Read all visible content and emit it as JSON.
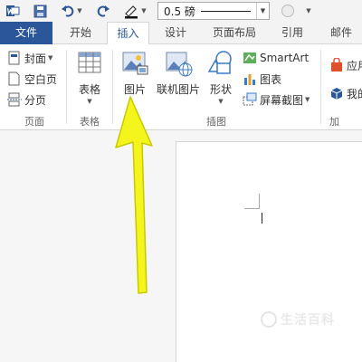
{
  "qat": {
    "line_weight": "0.5 磅"
  },
  "tabs": [
    {
      "label": "文件"
    },
    {
      "label": "开始"
    },
    {
      "label": "插入"
    },
    {
      "label": "设计"
    },
    {
      "label": "页面布局"
    },
    {
      "label": "引用"
    },
    {
      "label": "邮件"
    }
  ],
  "ribbon": {
    "pages": {
      "cover": "封面",
      "blank": "空白页",
      "break": "分页",
      "group_label": "页面"
    },
    "tables": {
      "table": "表格",
      "group_label": "表格"
    },
    "illustrations": {
      "picture": "图片",
      "online_picture": "联机图片",
      "shapes": "形状",
      "smartart": "SmartArt",
      "chart": "图表",
      "screenshot": "屏幕截图",
      "group_label": "插图"
    },
    "addins": {
      "apps": "应用",
      "wiki": "我的",
      "group_label": "加"
    }
  },
  "watermark": {
    "text": "生活百科"
  },
  "colors": {
    "word_blue": "#2b579a",
    "arrow_yellow": "#f5f51e"
  }
}
